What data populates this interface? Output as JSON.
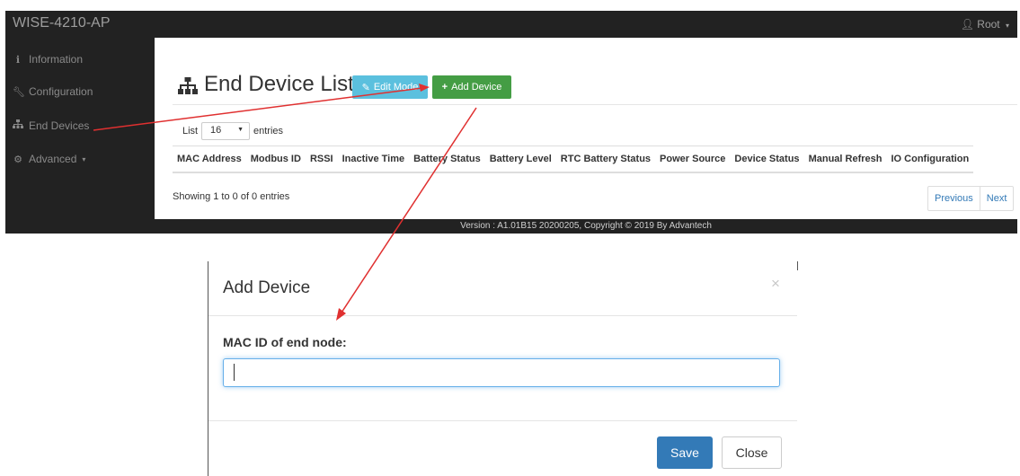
{
  "app": {
    "brand": "WISE-4210-AP",
    "user_label": "Root",
    "user_caret": "▾"
  },
  "sidebar": {
    "items": [
      {
        "label": "Information"
      },
      {
        "label": "Configuration"
      },
      {
        "label": "End Devices"
      },
      {
        "label": "Advanced",
        "caret": "▾"
      }
    ]
  },
  "page": {
    "title": "End Device List",
    "edit_mode_label": "Edit Mode",
    "add_device_label": "Add Device",
    "list_label": "List",
    "list_value": "16",
    "entries_label": "entries",
    "showing_text": "Showing 1 to 0 of 0 entries",
    "previous_label": "Previous",
    "next_label": "Next"
  },
  "table": {
    "columns": [
      "MAC Address",
      "Modbus ID",
      "RSSI",
      "Inactive Time",
      "Battery Status",
      "Battery Level",
      "RTC Battery Status",
      "Power Source",
      "Device Status",
      "Manual Refresh",
      "IO Configuration"
    ],
    "rows": []
  },
  "footer": {
    "text": "Version : A1.01B15 20200205, Copyright © 2019 By Advantech"
  },
  "modal": {
    "title": "Add Device",
    "close_glyph": "×",
    "field_label": "MAC ID of end node:",
    "field_value": "",
    "save_label": "Save",
    "close_label": "Close"
  },
  "colors": {
    "navbar": "#222222",
    "edit_button": "#5bc0de",
    "add_button": "#449d44",
    "save_button": "#337ab7",
    "annotation_arrow": "#e03030"
  }
}
